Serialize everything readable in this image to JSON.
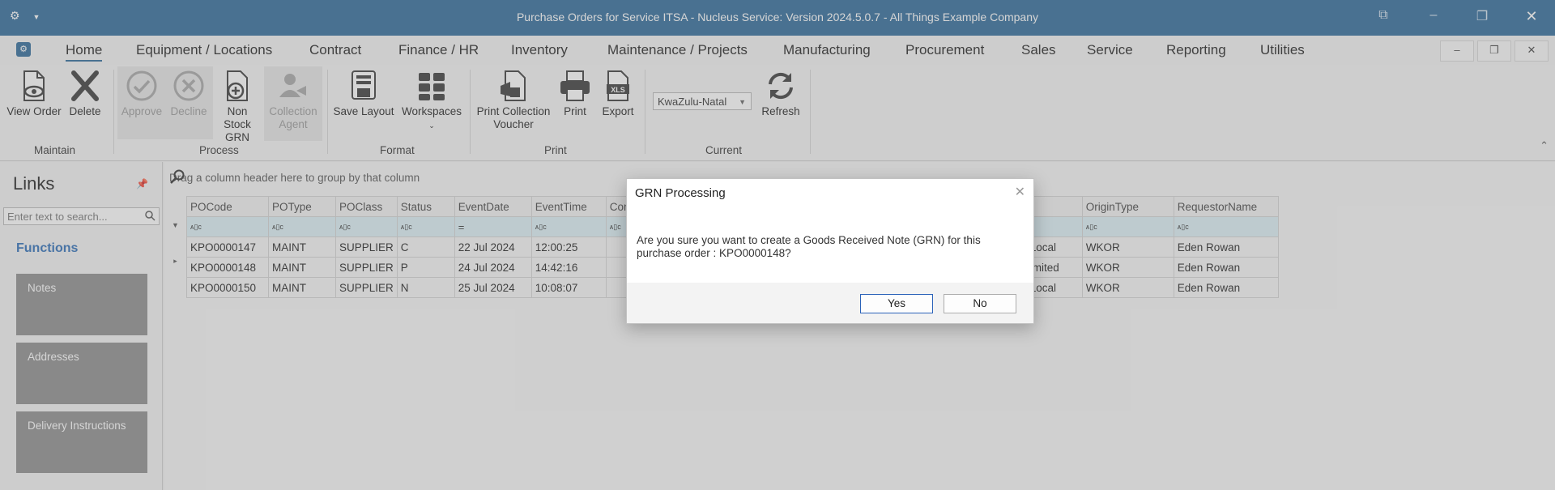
{
  "window": {
    "title": "Purchase Orders for Service ITSA - Nucleus Service: Version 2024.5.0.7 - All Things Example Company",
    "left_icons": [
      "gear-icon",
      "chevron-down-icon"
    ],
    "controls": [
      "restore-icon",
      "minimize-icon",
      "maximize-icon",
      "close-icon"
    ]
  },
  "menu": {
    "tabs": [
      {
        "label": "Home",
        "active": true
      },
      {
        "label": "Equipment / Locations"
      },
      {
        "label": "Contract"
      },
      {
        "label": "Finance / HR"
      },
      {
        "label": "Inventory"
      },
      {
        "label": "Maintenance / Projects"
      },
      {
        "label": "Manufacturing"
      },
      {
        "label": "Procurement"
      },
      {
        "label": "Sales"
      },
      {
        "label": "Service"
      },
      {
        "label": "Reporting"
      },
      {
        "label": "Utilities"
      }
    ],
    "window_buttons": [
      "–",
      "❐",
      "✕"
    ]
  },
  "ribbon": {
    "groups": {
      "maintain": "Maintain",
      "process": "Process",
      "format": "Format",
      "print": "Print",
      "current": "Current"
    },
    "buttons": {
      "view_order": "View Order",
      "delete": "Delete",
      "approve": "Approve",
      "decline": "Decline",
      "non_stock_grn_1": "Non Stock",
      "non_stock_grn_2": "GRN",
      "collection_agent_1": "Collection",
      "collection_agent_2": "Agent",
      "save_layout": "Save Layout",
      "workspaces": "Workspaces",
      "print_collection_voucher_1": "Print Collection",
      "print_collection_voucher_2": "Voucher",
      "print": "Print",
      "export": "Export",
      "refresh": "Refresh"
    },
    "region": "KwaZulu-Natal",
    "export_badge": "XLS"
  },
  "links": {
    "title": "Links",
    "search_placeholder": "Enter text to search...",
    "functions": "Functions",
    "tiles": [
      "Notes",
      "Addresses",
      "Delivery Instructions"
    ]
  },
  "grid": {
    "group_hint": "Drag a column header here to group by that column",
    "columns": [
      "POCode",
      "POType",
      "POClass",
      "Status",
      "EventDate",
      "EventTime",
      "Con",
      "",
      "OriginType",
      "RequestorName"
    ],
    "filter_glyph": "ᴀ▯c",
    "date_filter_glyph": "=",
    "rows": [
      [
        "KPO0000147",
        "MAINT",
        "SUPPLIER",
        "C",
        "22 Jul 2024",
        "12:00:25",
        "",
        "Local",
        "WKOR",
        "Eden Rowan"
      ],
      [
        "KPO0000148",
        "MAINT",
        "SUPPLIER",
        "P",
        "24 Jul 2024",
        "14:42:16",
        "",
        "imited",
        "WKOR",
        "Eden Rowan"
      ],
      [
        "KPO0000150",
        "MAINT",
        "SUPPLIER",
        "N",
        "25 Jul 2024",
        "10:08:07",
        "",
        "Local",
        "WKOR",
        "Eden Rowan"
      ]
    ],
    "current_row_indicator": "▸"
  },
  "dialog": {
    "title": "GRN Processing",
    "message": "Are you sure you want to create a Goods Received Note (GRN) for this purchase order : KPO0000148?",
    "yes": "Yes",
    "no": "No"
  },
  "colors": {
    "title_bar": "#2f6b9a",
    "accent_blue": "#2f6fb8",
    "tile_gray": "#8e8e8e",
    "filter_row": "#ddf0f6"
  }
}
